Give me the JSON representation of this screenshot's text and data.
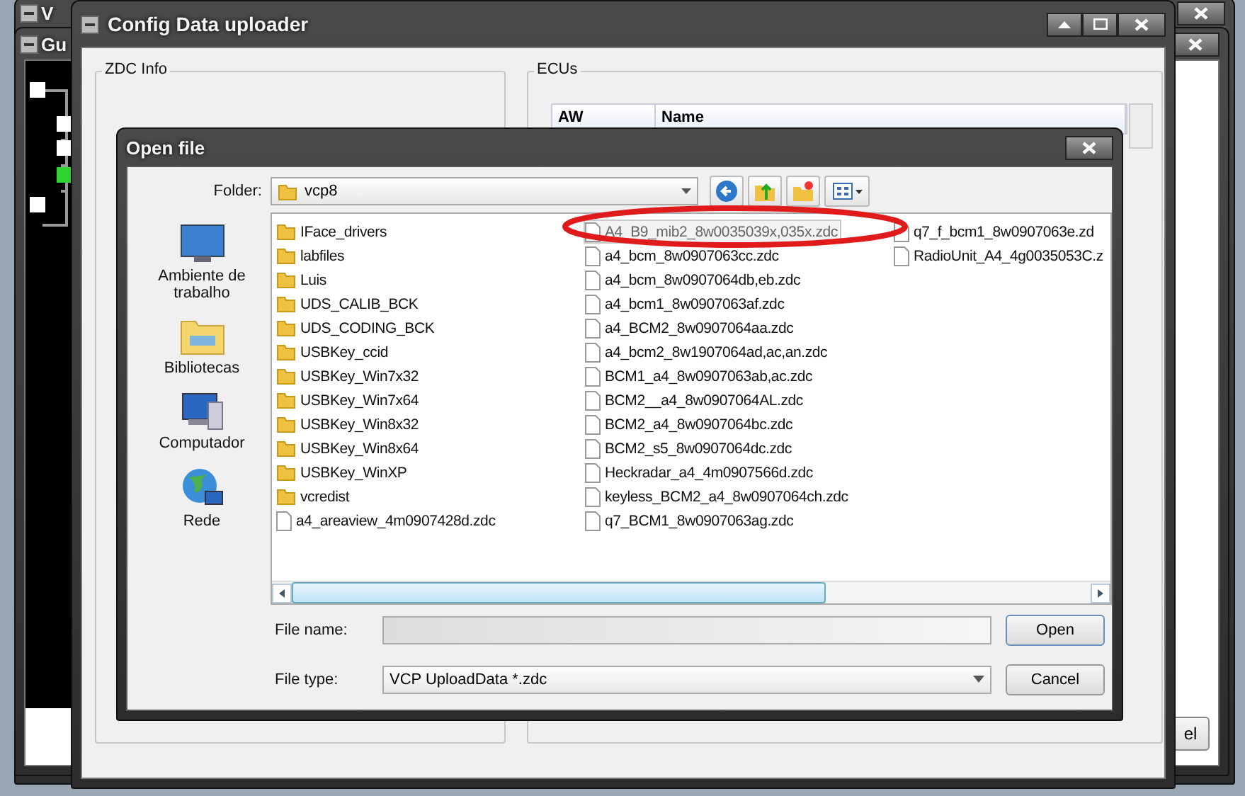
{
  "background_windows": [
    {
      "title": "V"
    },
    {
      "title": "Gu"
    }
  ],
  "back_button": {
    "label": "el"
  },
  "main_window": {
    "title": "Config Data uploader",
    "groups": [
      {
        "title": "ZDC Info"
      },
      {
        "title": "ECUs"
      }
    ],
    "ecu_table": {
      "columns": [
        "AW",
        "Name"
      ]
    }
  },
  "dialog": {
    "title": "Open file",
    "folder_label": "Folder:",
    "folder": "vcp8",
    "places": [
      {
        "label": "Ambiente de trabalho",
        "kind": "desktop"
      },
      {
        "label": "Bibliotecas",
        "kind": "libraries"
      },
      {
        "label": "Computador",
        "kind": "computer"
      },
      {
        "label": "Rede",
        "kind": "network"
      }
    ],
    "file_columns": [
      [
        {
          "name": "IFace_drivers",
          "kind": "folder",
          "selected": false
        },
        {
          "name": "labfiles",
          "kind": "folder",
          "selected": false
        },
        {
          "name": "Luis",
          "kind": "folder",
          "selected": false
        },
        {
          "name": "UDS_CALIB_BCK",
          "kind": "folder",
          "selected": false
        },
        {
          "name": "UDS_CODING_BCK",
          "kind": "folder",
          "selected": false
        },
        {
          "name": "USBKey_ccid",
          "kind": "folder",
          "selected": false
        },
        {
          "name": "USBKey_Win7x32",
          "kind": "folder",
          "selected": false
        },
        {
          "name": "USBKey_Win7x64",
          "kind": "folder",
          "selected": false
        },
        {
          "name": "USBKey_Win8x32",
          "kind": "folder",
          "selected": false
        },
        {
          "name": "USBKey_Win8x64",
          "kind": "folder",
          "selected": false
        },
        {
          "name": "USBKey_WinXP",
          "kind": "folder",
          "selected": false
        },
        {
          "name": "vcredist",
          "kind": "folder",
          "selected": false
        },
        {
          "name": "a4_areaview_4m0907428d.zdc",
          "kind": "file",
          "selected": false
        }
      ],
      [
        {
          "name": "A4_B9_mib2_8w0035039x,035x.zdc",
          "kind": "file",
          "selected": true
        },
        {
          "name": "a4_bcm_8w0907063cc.zdc",
          "kind": "file",
          "selected": false
        },
        {
          "name": "a4_bcm_8w0907064db,eb.zdc",
          "kind": "file",
          "selected": false
        },
        {
          "name": "a4_bcm1_8w0907063af.zdc",
          "kind": "file",
          "selected": false
        },
        {
          "name": "a4_BCM2_8w0907064aa.zdc",
          "kind": "file",
          "selected": false
        },
        {
          "name": "a4_bcm2_8w1907064ad,ac,an.zdc",
          "kind": "file",
          "selected": false
        },
        {
          "name": "BCM1_a4_8w0907063ab,ac.zdc",
          "kind": "file",
          "selected": false
        },
        {
          "name": "BCM2__a4_8w0907064AL.zdc",
          "kind": "file",
          "selected": false
        },
        {
          "name": "BCM2_a4_8w0907064bc.zdc",
          "kind": "file",
          "selected": false
        },
        {
          "name": "BCM2_s5_8w0907064dc.zdc",
          "kind": "file",
          "selected": false
        },
        {
          "name": "Heckradar_a4_4m0907566d.zdc",
          "kind": "file",
          "selected": false
        },
        {
          "name": "keyless_BCM2_a4_8w0907064ch.zdc",
          "kind": "file",
          "selected": false
        },
        {
          "name": "q7_BCM1_8w0907063ag.zdc",
          "kind": "file",
          "selected": false
        }
      ],
      [
        {
          "name": "q7_f_bcm1_8w0907063e.zd",
          "kind": "file",
          "selected": false
        },
        {
          "name": "RadioUnit_A4_4g0035053C.z",
          "kind": "file",
          "selected": false
        }
      ]
    ],
    "file_name_label": "File name:",
    "file_type_label": "File type:",
    "file_type": "VCP UploadData *.zdc",
    "buttons": [
      {
        "label": "Open",
        "kind": "default"
      },
      {
        "label": "Cancel",
        "kind": "normal"
      }
    ]
  }
}
